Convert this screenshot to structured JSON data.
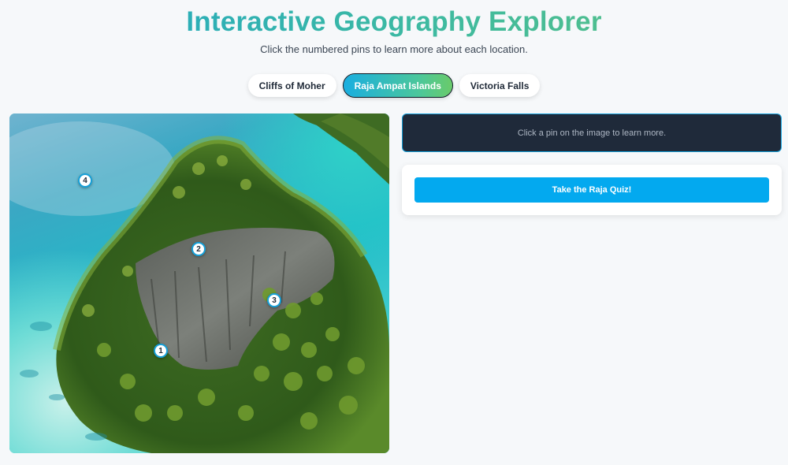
{
  "header": {
    "title": "Interactive Geography Explorer",
    "subtitle": "Click the numbered pins to learn more about each location."
  },
  "tabs": [
    {
      "label": "Cliffs of Moher",
      "active": false
    },
    {
      "label": "Raja Ampat Islands",
      "active": true
    },
    {
      "label": "Victoria Falls",
      "active": false
    }
  ],
  "image": {
    "alt_subject": "Aerial view of a forested limestone island surrounded by turquoise water",
    "pins": [
      {
        "label": "1"
      },
      {
        "label": "2"
      },
      {
        "label": "3"
      },
      {
        "label": "4"
      }
    ]
  },
  "info": {
    "message": "Click a pin on the image to learn more."
  },
  "quiz": {
    "button_label": "Take the Raja Quiz!"
  },
  "colors": {
    "accent_blue": "#03a9ef",
    "info_bg": "#1f2a3a",
    "gradient_start": "#1fa6c8",
    "gradient_end": "#5fc27e"
  }
}
